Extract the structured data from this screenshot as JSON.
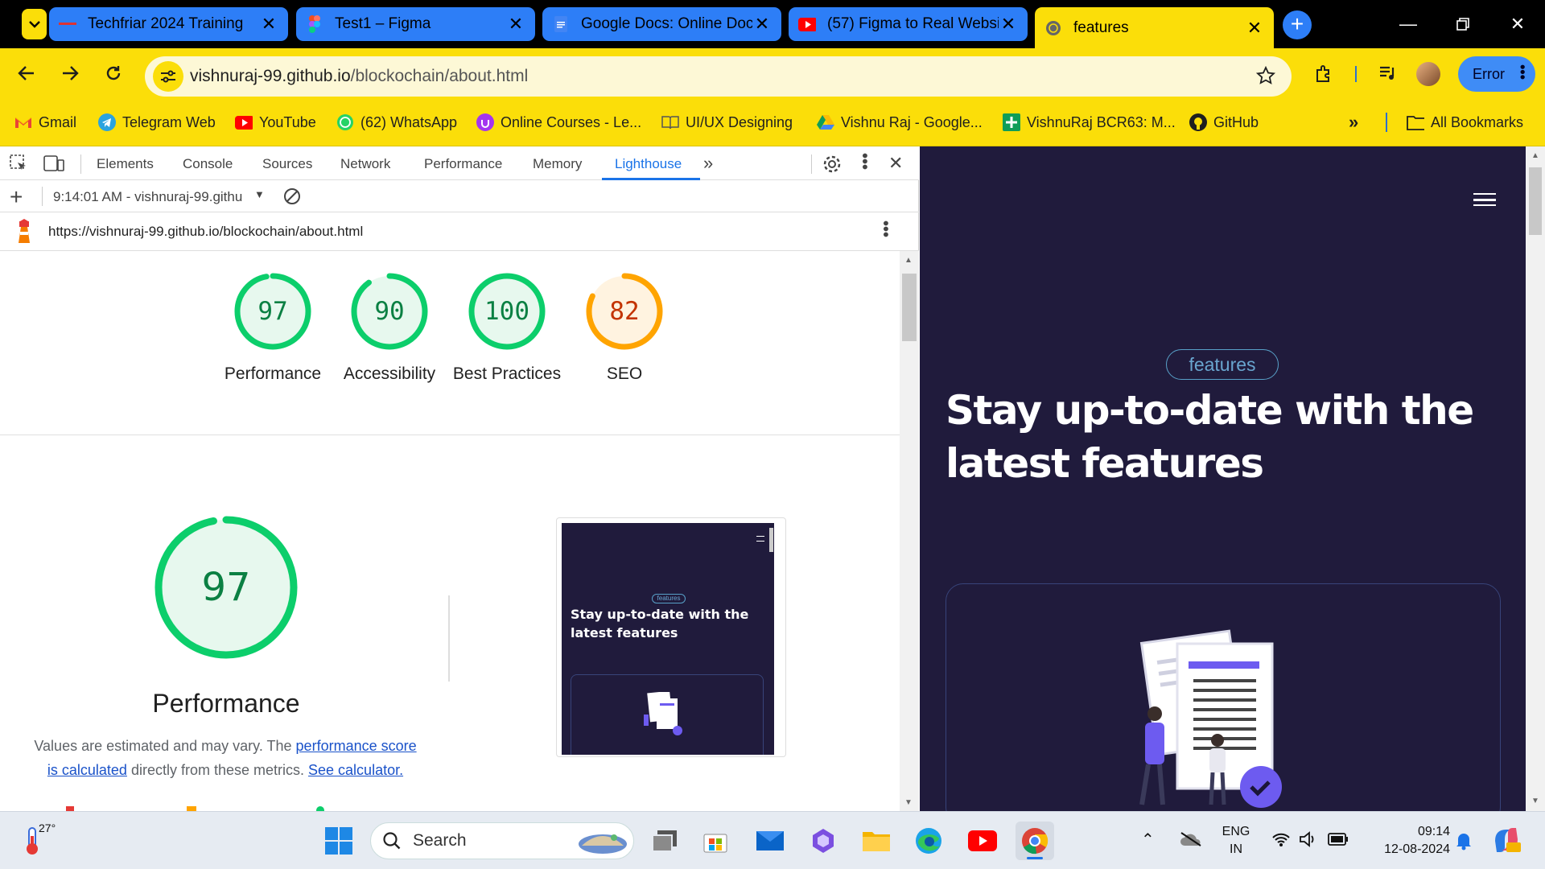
{
  "tabs": [
    {
      "title": "Techfriar 2024 Training",
      "icon": "techfriar-icon"
    },
    {
      "title": "Test1 – Figma",
      "icon": "figma-icon"
    },
    {
      "title": "Google Docs: Online Doc",
      "icon": "docs-icon"
    },
    {
      "title": "(57) Figma to Real Websi",
      "icon": "youtube-icon"
    },
    {
      "title": "features",
      "icon": "globe-icon",
      "active": true
    }
  ],
  "omnibox": {
    "host": "vishnuraj-99.github.io",
    "path": "/blockochain/about.html"
  },
  "error_button": "Error",
  "bookmarks": [
    {
      "label": "Gmail",
      "icon": "gmail-icon"
    },
    {
      "label": "Telegram Web",
      "icon": "telegram-icon"
    },
    {
      "label": "YouTube",
      "icon": "youtube-icon"
    },
    {
      "label": "(62) WhatsApp",
      "icon": "whatsapp-icon"
    },
    {
      "label": "Online Courses - Le...",
      "icon": "udemy-icon"
    },
    {
      "label": "UI/UX Designing",
      "icon": "book-icon"
    },
    {
      "label": "Vishnu Raj - Google...",
      "icon": "drive-icon"
    },
    {
      "label": "VishnuRaj BCR63: M...",
      "icon": "sheets-icon"
    },
    {
      "label": "GitHub",
      "icon": "github-icon"
    },
    {
      "label": "All Bookmarks",
      "icon": "folder-icon"
    }
  ],
  "devtools": {
    "tabs": [
      "Elements",
      "Console",
      "Sources",
      "Network",
      "Performance",
      "Memory",
      "Lighthouse"
    ],
    "active_tab": "Lighthouse",
    "report_select": "9:14:01 AM - vishnuraj-99.githu",
    "report_url": "https://vishnuraj-99.github.io/blockochain/about.html"
  },
  "lighthouse": {
    "scores": [
      {
        "label": "Performance",
        "value": 97,
        "color": "#0cce6b"
      },
      {
        "label": "Accessibility",
        "value": 90,
        "color": "#0cce6b"
      },
      {
        "label": "Best Practices",
        "value": 100,
        "color": "#0cce6b"
      },
      {
        "label": "SEO",
        "value": 82,
        "color": "#ffa400"
      }
    ],
    "perf_title": "Performance",
    "perf_value": 97,
    "desc_prefix": "Values are estimated and may vary. The ",
    "desc_link1": "performance score is calculated",
    "desc_mid": " directly from these metrics. ",
    "desc_link2": "See calculator.",
    "thumb_pill": "features",
    "thumb_headline": "Stay up-to-date with the latest features"
  },
  "page": {
    "pill": "features",
    "headline": "Stay up-to-date with the latest features"
  },
  "taskbar": {
    "temperature": "27°",
    "search_placeholder": "Search",
    "lang_top": "ENG",
    "lang_bottom": "IN",
    "time": "09:14",
    "date": "12-08-2024"
  },
  "colors": {
    "chrome_yellow": "#fbde09",
    "tab_blue": "#2d7ef7",
    "page_bg": "#201b3c",
    "accent_purple": "#6d5bf0"
  }
}
